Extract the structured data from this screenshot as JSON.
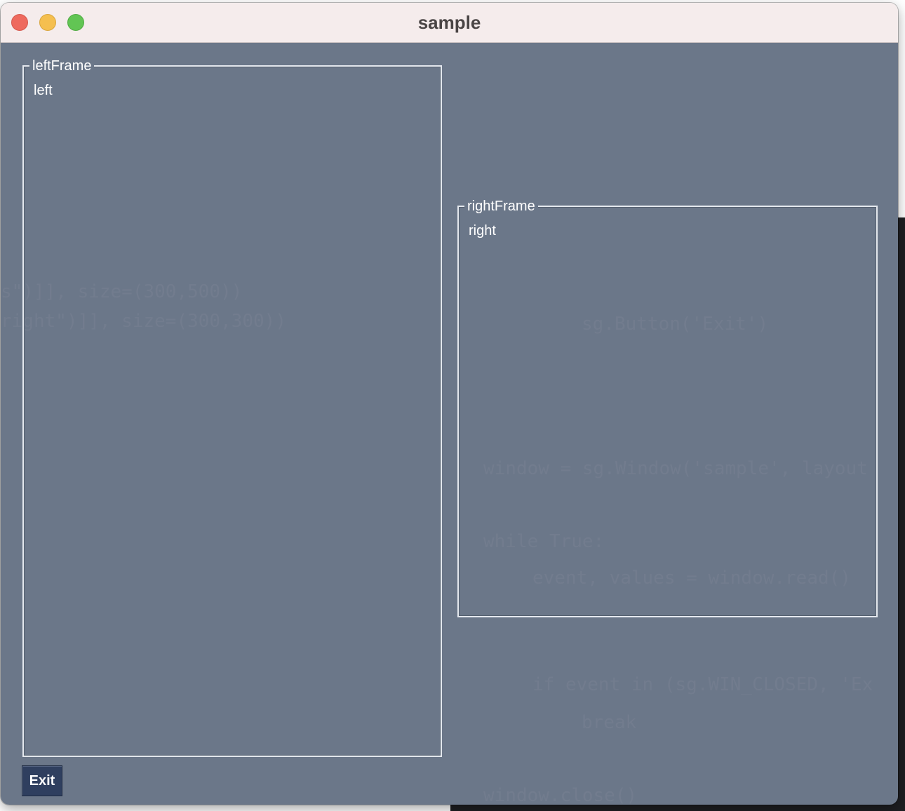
{
  "window": {
    "title": "sample"
  },
  "left_frame": {
    "legend": "leftFrame",
    "text": "left"
  },
  "right_frame": {
    "legend": "rightFrame",
    "text": "right"
  },
  "exit_button": {
    "label": "Exit"
  },
  "background_code": {
    "line1": "s\")]], size=(300,500))",
    "line2": "right\")]], size=(300,300))",
    "line3": "sg.Button('Exit')",
    "line4": "window = sg.Window('sample', layout",
    "line5": "while True:",
    "line6": "event, values = window.read()",
    "line7": "if event in (sg.WIN_CLOSED, 'Ex",
    "line8": "break",
    "line9": "window.close()"
  },
  "colors": {
    "window_bg": "#6b7789",
    "button_bg": "#2f3f5f",
    "titlebar_bg": "#f5ecec"
  }
}
